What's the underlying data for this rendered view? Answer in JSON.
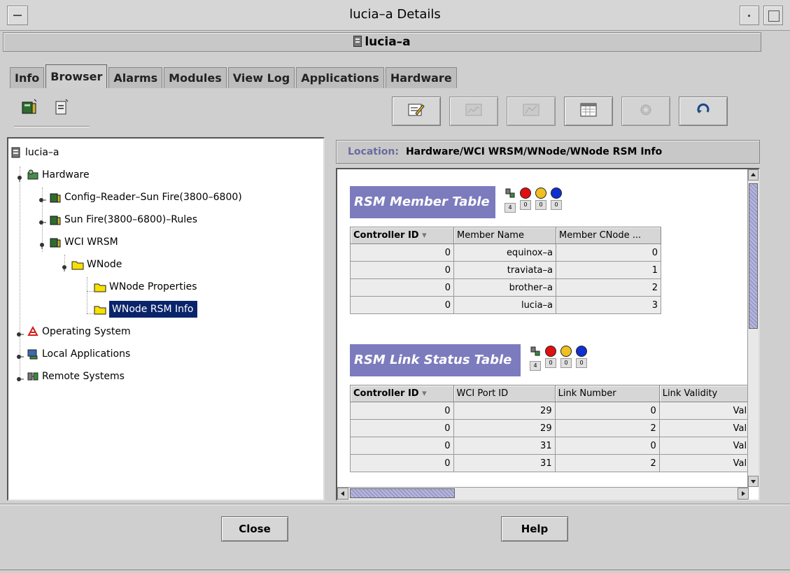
{
  "window": {
    "title": "lucia–a Details",
    "host": "lucia–a"
  },
  "tabs": [
    "Info",
    "Browser",
    "Alarms",
    "Modules",
    "View Log",
    "Applications",
    "Hardware"
  ],
  "active_tab": "Browser",
  "toolbar_right": {
    "buttons": [
      "edit-icon",
      "graph-icon",
      "chart-icon",
      "calendar-icon",
      "refresh-disabled-icon",
      "reload-icon"
    ]
  },
  "tree": {
    "root": "lucia–a",
    "items": [
      {
        "label": "Hardware"
      },
      {
        "label": "Config–Reader–Sun Fire(3800–6800)"
      },
      {
        "label": "Sun Fire(3800–6800)–Rules"
      },
      {
        "label": "WCI WRSM"
      },
      {
        "label": "WNode"
      },
      {
        "label": "WNode Properties"
      },
      {
        "label": "WNode RSM Info"
      },
      {
        "label": "Operating System"
      },
      {
        "label": "Local Applications"
      },
      {
        "label": "Remote Systems"
      }
    ]
  },
  "location": {
    "label": "Location:",
    "path": "Hardware/WCI WRSM/WNode/WNode RSM Info"
  },
  "member_table": {
    "title": "RSM Member Table",
    "counts": [
      "4",
      "0",
      "0",
      "0"
    ],
    "headers": [
      "Controller ID",
      "Member Name",
      "Member CNode ..."
    ],
    "rows": [
      [
        "0",
        "equinox–a",
        "0"
      ],
      [
        "0",
        "traviata–a",
        "1"
      ],
      [
        "0",
        "brother–a",
        "2"
      ],
      [
        "0",
        "lucia–a",
        "3"
      ]
    ]
  },
  "link_table": {
    "title": "RSM Link Status Table",
    "counts": [
      "4",
      "0",
      "0",
      "0"
    ],
    "headers": [
      "Controller ID",
      "WCI Port ID",
      "Link Number",
      "Link Validity"
    ],
    "rows": [
      [
        "0",
        "29",
        "0",
        "Valid"
      ],
      [
        "0",
        "29",
        "2",
        "Valid"
      ],
      [
        "0",
        "31",
        "0",
        "Valid"
      ],
      [
        "0",
        "31",
        "2",
        "Valid"
      ]
    ]
  },
  "footer": {
    "close_label": "Close",
    "help_label": "Help"
  },
  "colors": {
    "accent": "#7b7bbd",
    "selection": "#0a246a"
  }
}
